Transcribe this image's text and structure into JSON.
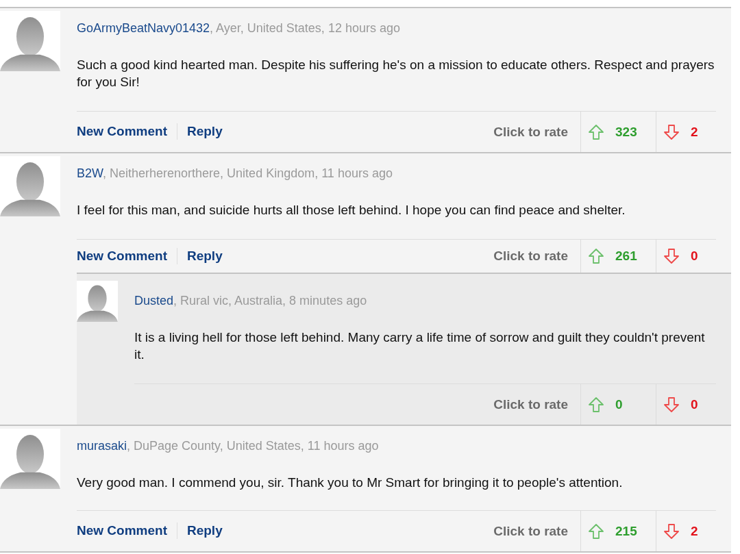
{
  "comments": [
    {
      "author": "GoArmyBeatNavy01432",
      "meta": ", Ayer, United States, 12 hours ago",
      "text": "Such a good kind hearted man. Despite his suffering he's on a mission to educate others. Respect and prayers for you Sir!",
      "actions": [
        "New Comment",
        "Reply"
      ],
      "rate_label": "Click to rate",
      "up": "323",
      "down": "2"
    },
    {
      "author": "B2W",
      "meta": ", Neitherherenorthere, United Kingdom, 11 hours ago",
      "text": "I feel for this man, and suicide hurts all those left behind. I hope you can find peace and shelter.",
      "actions": [
        "New Comment",
        "Reply"
      ],
      "rate_label": "Click to rate",
      "up": "261",
      "down": "0",
      "replies": [
        {
          "author": "Dusted",
          "meta": ", Rural vic, Australia, 8 minutes ago",
          "text": "It is a living hell for those left behind. Many carry a life time of sorrow and guilt they couldn't prevent it.",
          "rate_label": "Click to rate",
          "up": "0",
          "down": "0"
        }
      ]
    },
    {
      "author": "murasaki",
      "meta": ", DuPage County, United States, 11 hours ago",
      "text": "Very good man. I commend you, sir. Thank you to Mr Smart for bringing it to people's attention.",
      "actions": [
        "New Comment",
        "Reply"
      ],
      "rate_label": "Click to rate",
      "up": "215",
      "down": "2"
    }
  ]
}
